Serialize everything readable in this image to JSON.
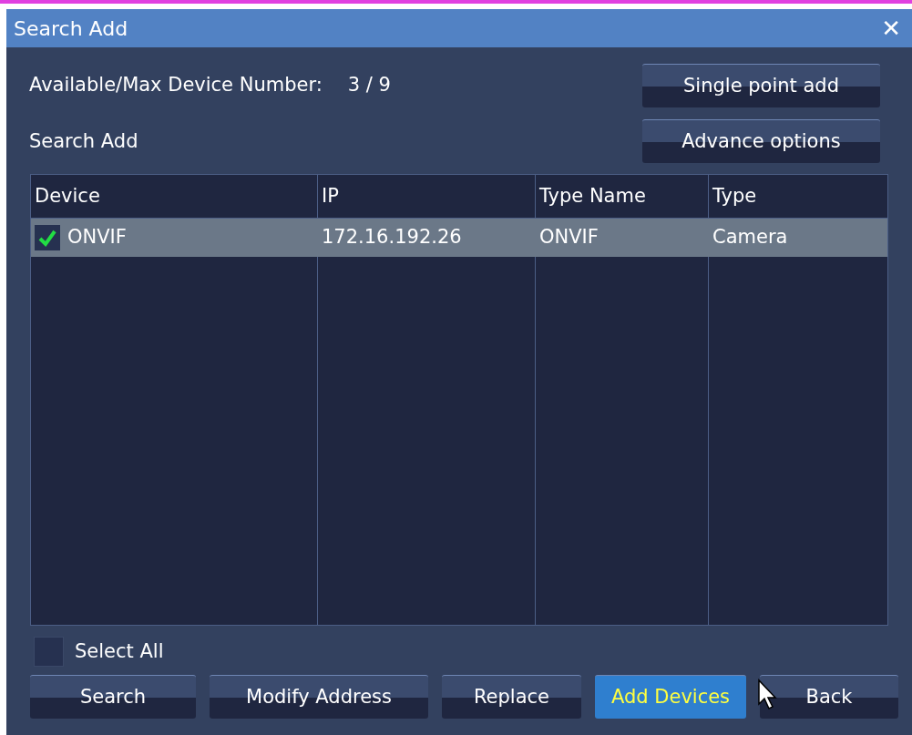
{
  "window": {
    "title": "Search Add",
    "close": "✕"
  },
  "device_count": {
    "label": "Available/Max Device Number:",
    "value": "3 / 9"
  },
  "section_label": "Search Add",
  "top_buttons": [
    "Single point add",
    "Advance options"
  ],
  "table": {
    "columns": [
      "Device",
      "IP",
      "Type Name",
      "Type"
    ],
    "rows": [
      {
        "checked": true,
        "selected": true,
        "cells": [
          "ONVIF",
          "172.16.192.26",
          "ONVIF",
          "Camera"
        ]
      }
    ]
  },
  "select_all": {
    "label": "Select All",
    "checked": false
  },
  "bottom_buttons": [
    {
      "label": "Search",
      "selected": false
    },
    {
      "label": "Modify Address",
      "selected": false
    },
    {
      "label": "Replace",
      "selected": false
    },
    {
      "label": "Add Devices",
      "selected": true
    },
    {
      "label": "Back",
      "selected": false
    }
  ]
}
